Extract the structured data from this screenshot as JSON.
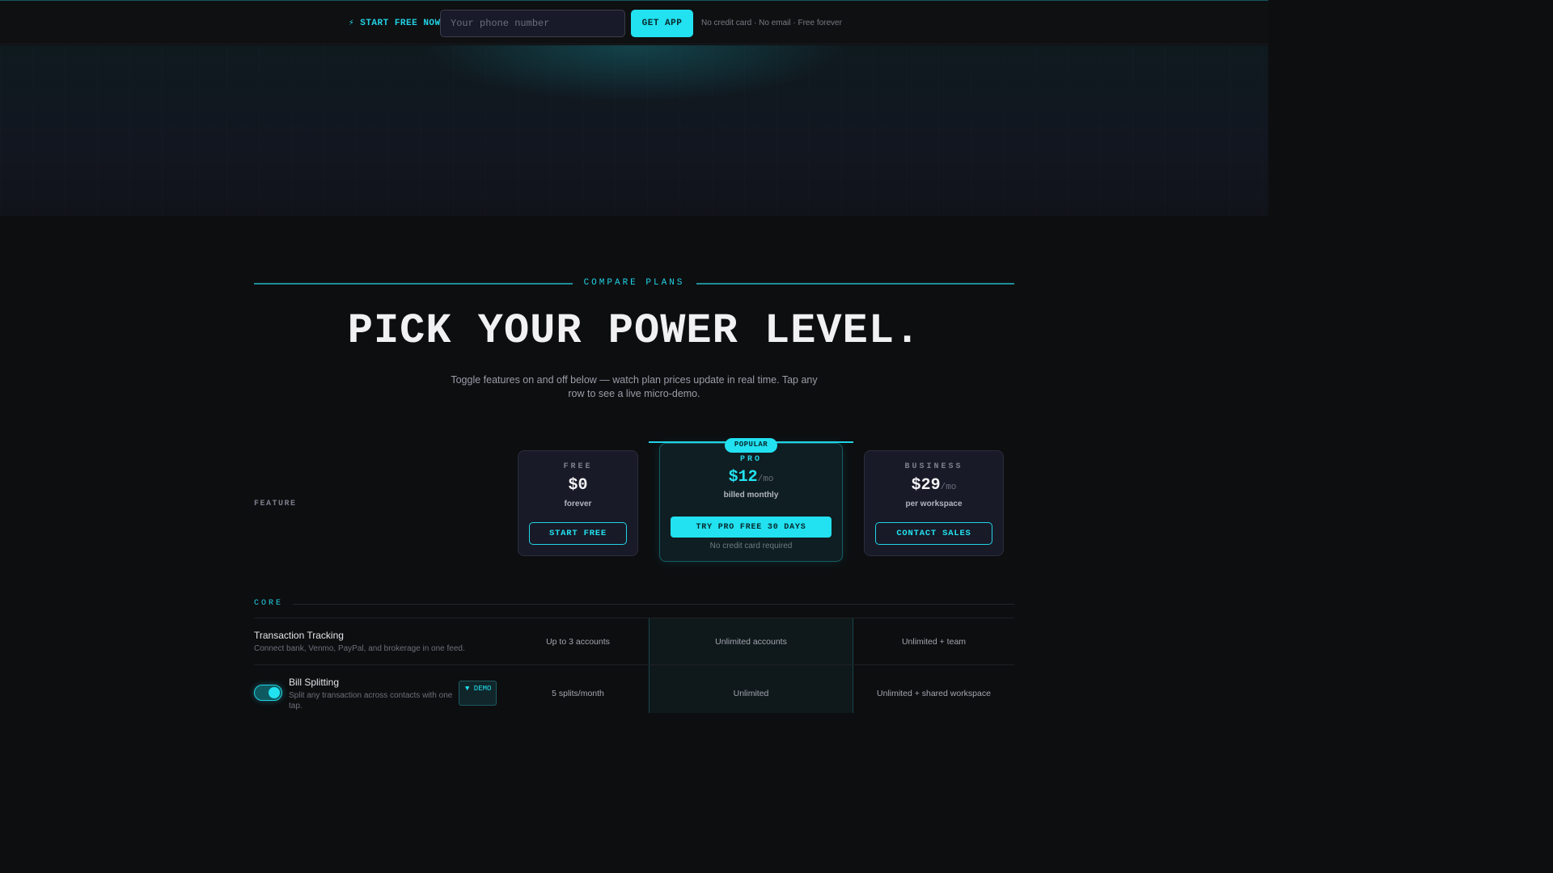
{
  "topbar": {
    "cta_label": "⚡ START FREE NOW",
    "phone_placeholder": "Your phone number",
    "get_app_label": "GET APP",
    "fine_print": "No credit card · No email · Free forever"
  },
  "compare": {
    "eyebrow": "COMPARE PLANS",
    "headline": "PICK YOUR POWER LEVEL.",
    "subline": "Toggle features on and off below — watch plan prices update in real time. Tap any row to see a live micro-demo."
  },
  "table": {
    "feature_header": "FEATURE"
  },
  "plans": {
    "free": {
      "name": "FREE",
      "price": "$0",
      "per": "",
      "sub": "forever",
      "button": "START FREE"
    },
    "pro": {
      "badge": "POPULAR",
      "name": "PRO",
      "price": "$12",
      "per": "/mo",
      "sub": "billed monthly",
      "button": "TRY PRO FREE 30 DAYS",
      "note": "No credit card required"
    },
    "business": {
      "name": "BUSINESS",
      "price": "$29",
      "per": "/mo",
      "sub": "per workspace",
      "button": "CONTACT SALES"
    }
  },
  "sections": {
    "core": {
      "label": "CORE",
      "rows": [
        {
          "title": "Transaction Tracking",
          "desc": "Connect bank, Venmo, PayPal, and brokerage in one feed.",
          "free": "Up to 3 accounts",
          "pro": "Unlimited accounts",
          "business": "Unlimited + team"
        },
        {
          "title": "Bill Splitting",
          "desc": "Split any transaction across contacts with one tap.",
          "demo": "▼ DEMO",
          "free": "5 splits/month",
          "pro": "Unlimited",
          "business": "Unlimited + shared workspace"
        }
      ]
    }
  },
  "colors": {
    "accent": "#22e1f0",
    "background": "#0d0e10",
    "card": "#181a28"
  }
}
